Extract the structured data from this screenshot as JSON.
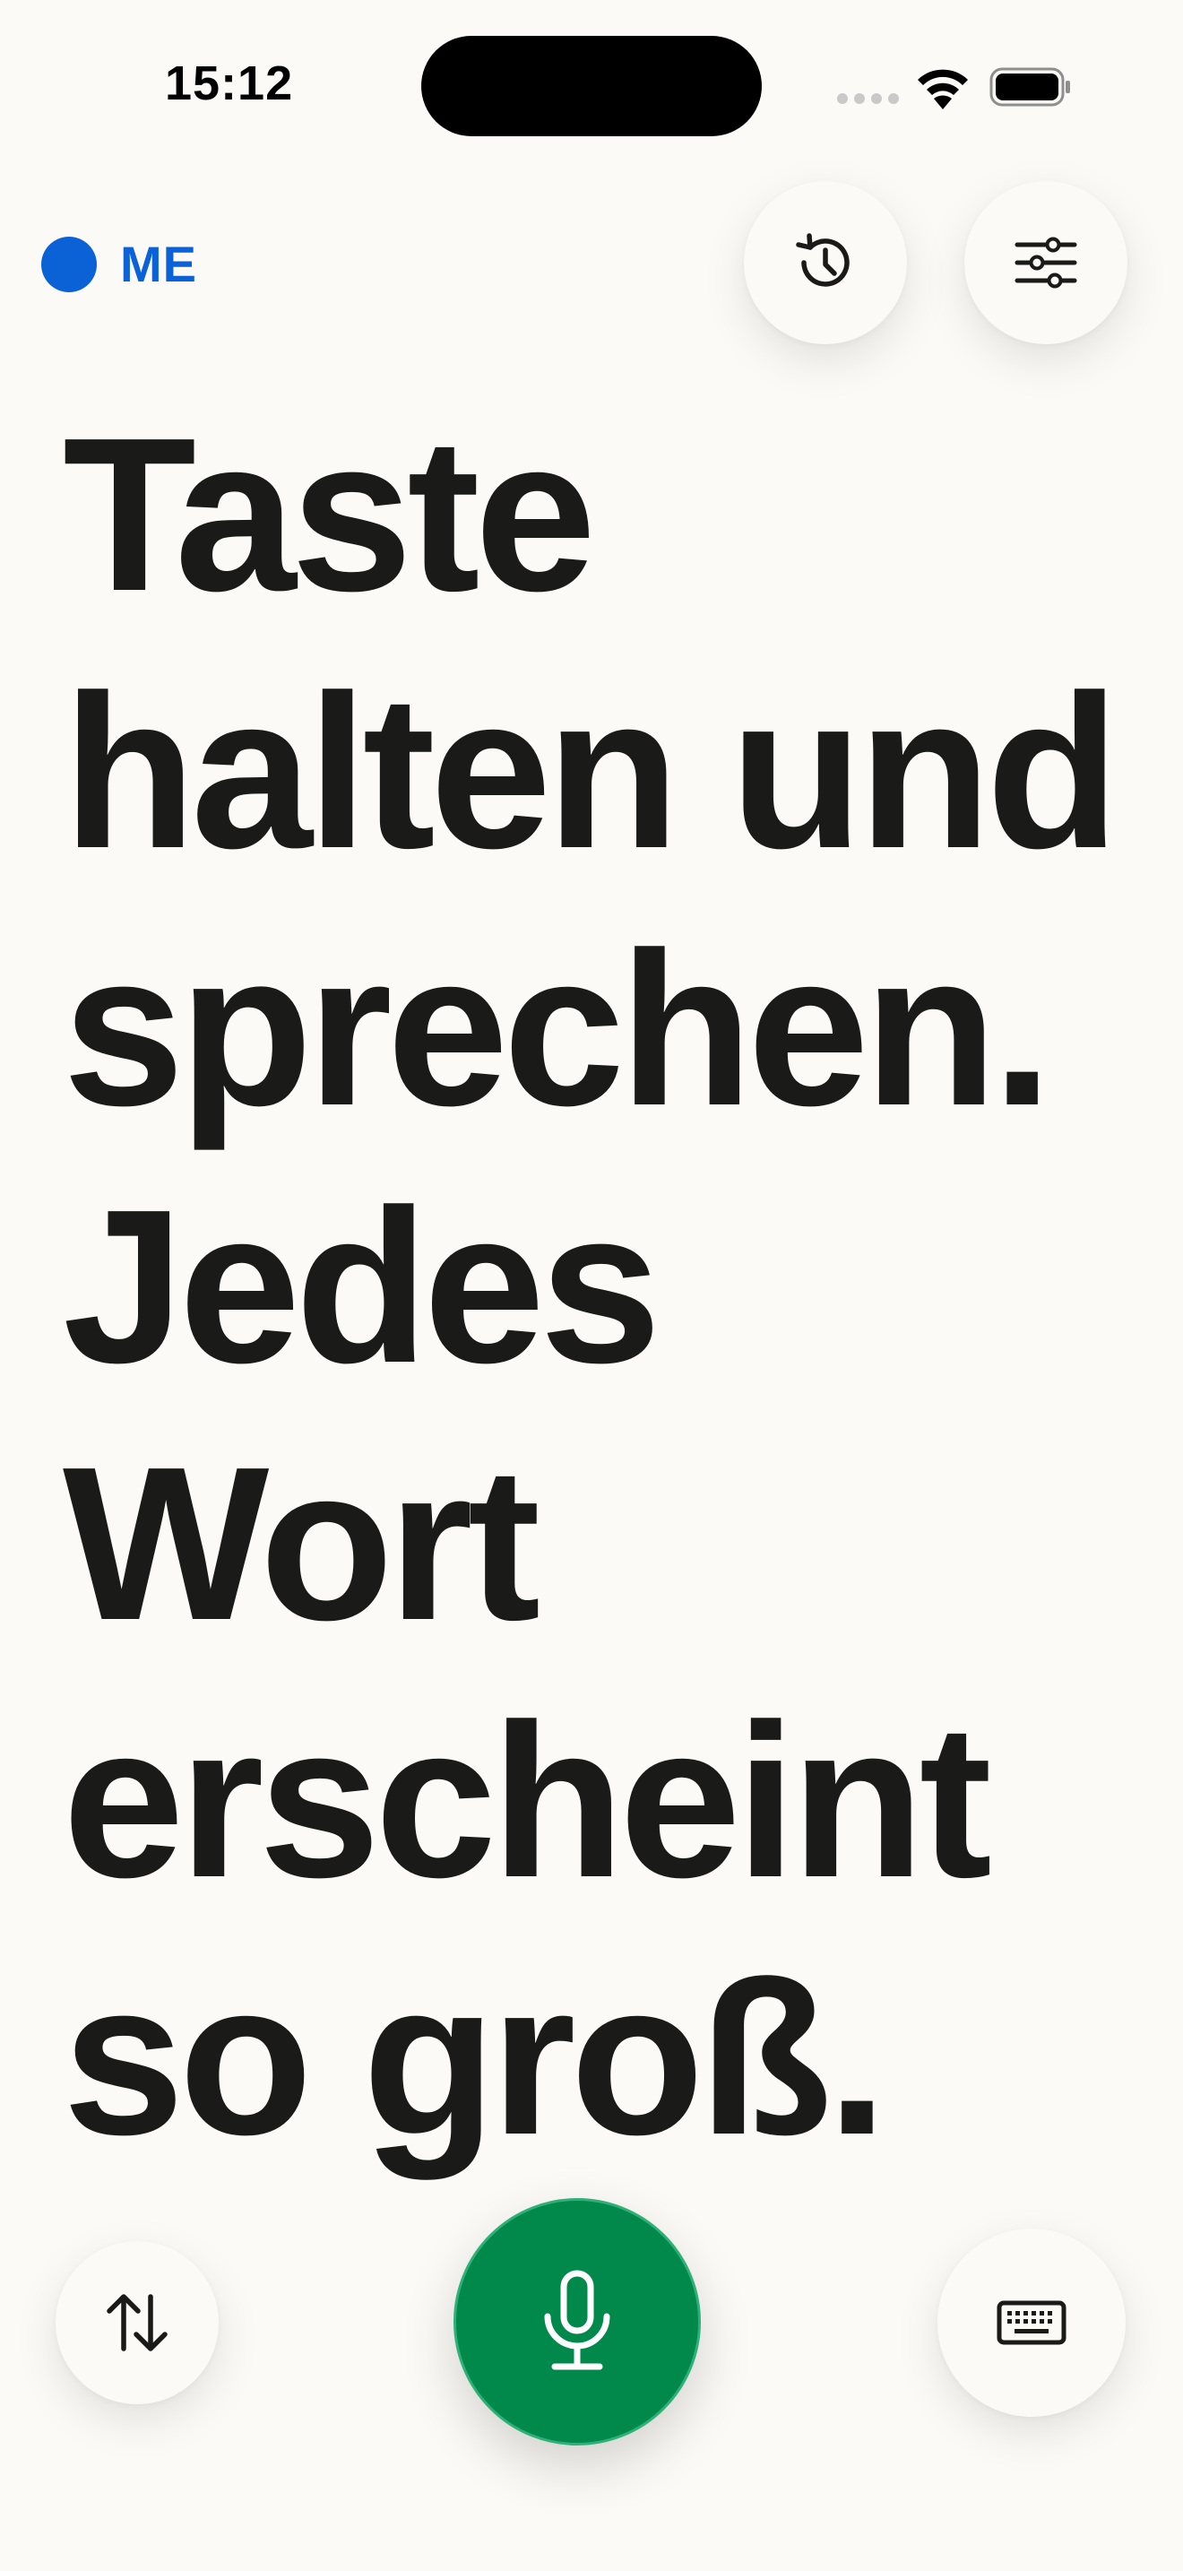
{
  "status_bar": {
    "time": "15:12"
  },
  "header": {
    "speaker_label": "ME",
    "speaker_color": "#0B62D6",
    "history_icon": "history-clock-icon",
    "settings_icon": "sliders-icon"
  },
  "main": {
    "text": "Taste halten und sprechen. Jedes Wort erscheint so groß."
  },
  "controls": {
    "swap_icon": "swap-arrows-icon",
    "mic_icon": "microphone-icon",
    "mic_color": "#00894A",
    "keyboard_icon": "keyboard-icon"
  }
}
